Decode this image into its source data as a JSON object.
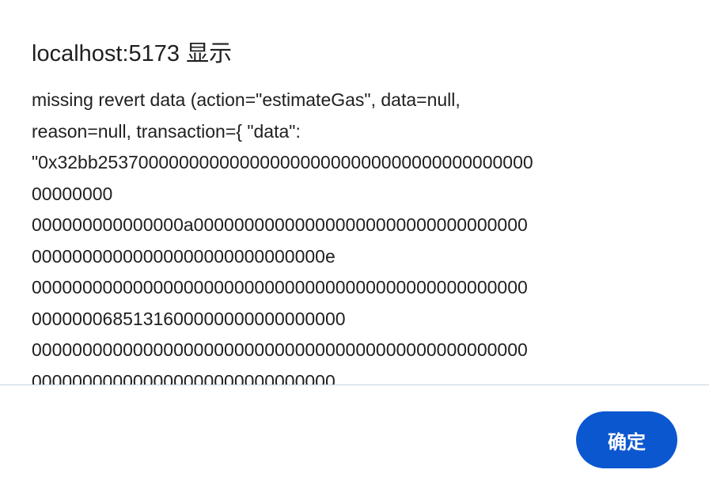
{
  "dialog": {
    "title": "localhost:5173 显示",
    "message": "missing revert data (action=\"estimateGas\", data=null,\nreason=null, transaction={ \"data\":\n\"0x32bb2537000000000000000000000000000000000000000\n00000000\n000000000000000a000000000000000000000000000000000\n00000000000000000000000000000e\n0000000000000000000000000000000000000000000000000\n0000000685131600000000000000000\n0000000000000000000000000000000000000000000000000\n000000000000000000000000000000",
    "ok_label": "确定"
  }
}
